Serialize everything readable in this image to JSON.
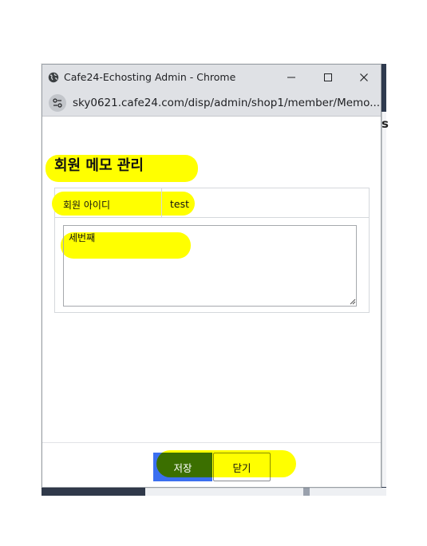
{
  "window": {
    "title": "Cafe24-Echosting Admin - Chrome",
    "url": "sky0621.cafe24.com/disp/admin/shop1/member/Memo..."
  },
  "background": {
    "partial_char": "s"
  },
  "dialog": {
    "heading": "회원 메모 관리",
    "member_id_label": "회원 아이디",
    "member_id_value": "test",
    "memo_text": "세번째",
    "save_label": "저장",
    "close_label": "닫기"
  },
  "colors": {
    "highlight": "#ffff00",
    "save_button": "#3b6ff0",
    "titlebar": "#dfe1e5"
  },
  "icons": [
    "globe-icon",
    "site-settings-icon",
    "minimize-icon",
    "maximize-icon",
    "close-icon",
    "resize-grip-icon"
  ]
}
